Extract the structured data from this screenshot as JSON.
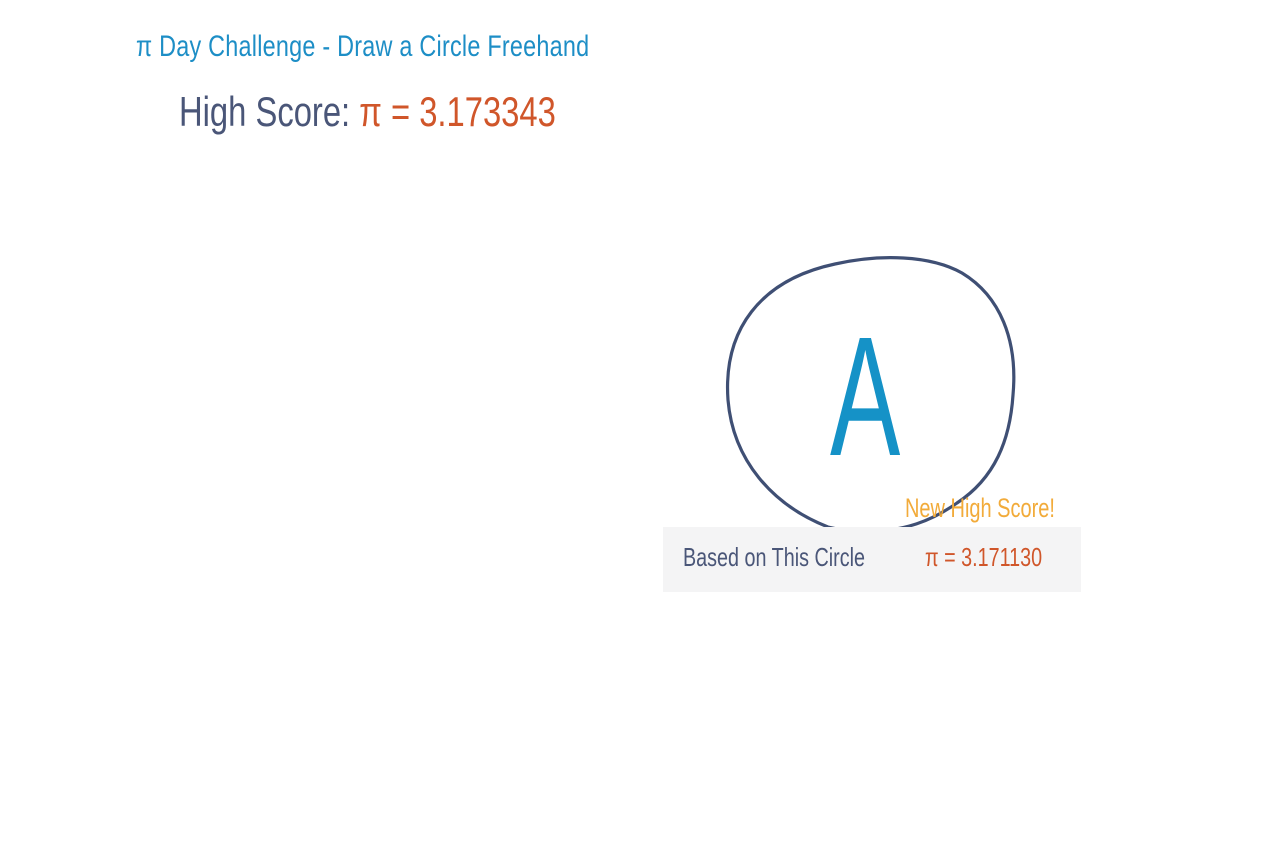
{
  "header": {
    "title": "π Day Challenge - Draw a Circle Freehand",
    "high_score_label": "High Score:",
    "high_score_value": "π = 3.173343"
  },
  "drawing": {
    "grade": "A",
    "stroke_color": "#3f4f74"
  },
  "result": {
    "badge": "New High Score!",
    "label": "Based on This Circle",
    "value": "π = 3.171130"
  },
  "colors": {
    "title_blue": "#1d8ec6",
    "score_orange": "#d0562a",
    "text_navy": "#4a5678",
    "badge_yellow": "#f2ab3a",
    "grade_blue": "#1592c7",
    "panel_bg": "#f4f4f5"
  }
}
